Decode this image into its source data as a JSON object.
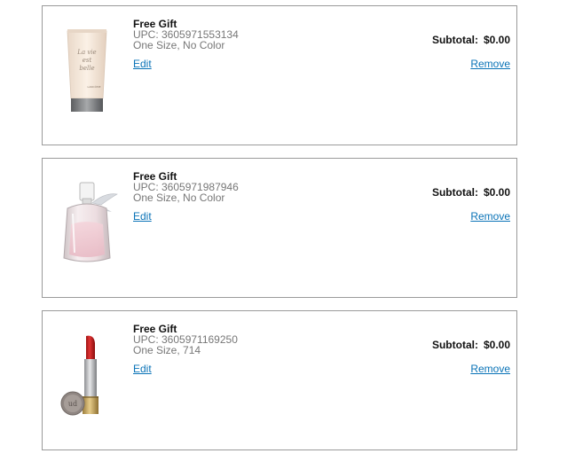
{
  "items": [
    {
      "title": "Free Gift",
      "upc": "UPC: 3605971553134",
      "variant": "One Size, No Color",
      "edit_label": "Edit",
      "subtotal_label": "Subtotal:",
      "subtotal_value": "$0.00",
      "remove_label": "Remove",
      "image": "la-vie-est-belle-lotion-tube"
    },
    {
      "title": "Free Gift",
      "upc": "UPC: 3605971987946",
      "variant": "One Size, No Color",
      "edit_label": "Edit",
      "subtotal_label": "Subtotal:",
      "subtotal_value": "$0.00",
      "remove_label": "Remove",
      "image": "perfume-bottle"
    },
    {
      "title": "Free Gift",
      "upc": "UPC: 3605971169250",
      "variant": "One Size, 714",
      "edit_label": "Edit",
      "subtotal_label": "Subtotal:",
      "subtotal_value": "$0.00",
      "remove_label": "Remove",
      "image": "red-lipstick"
    }
  ],
  "tube_lettering": [
    "La vie",
    "est",
    "belle",
    "LANCÔME"
  ],
  "colors": {
    "link": "#0a73b7",
    "border": "#9a9a9a",
    "meta_text": "#777777"
  }
}
